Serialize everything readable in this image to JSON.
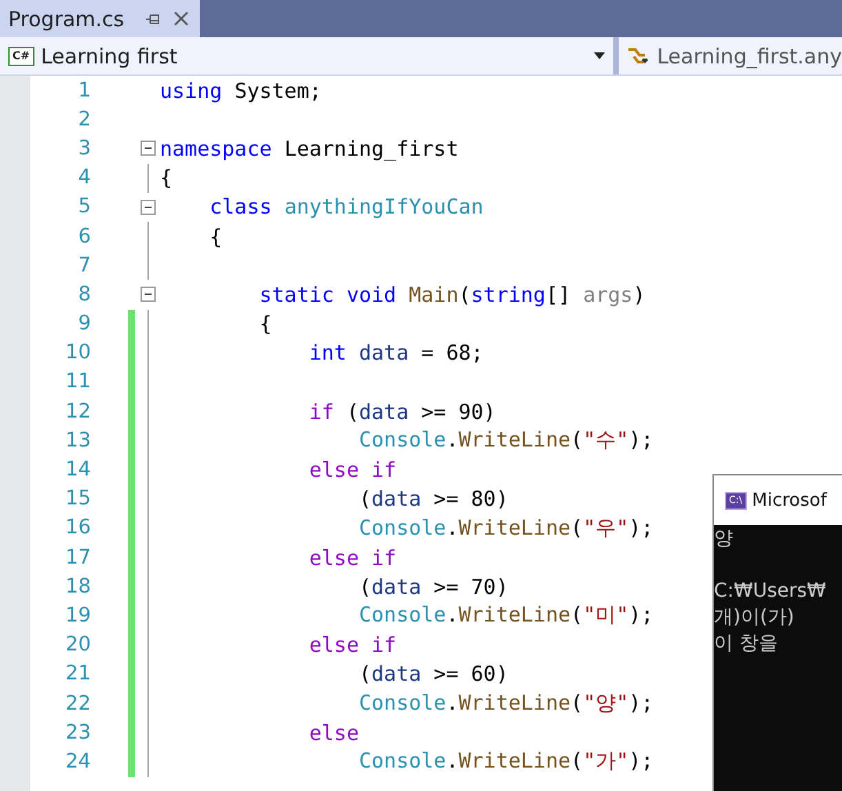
{
  "tab": {
    "title": "Program.cs",
    "selected": true
  },
  "nav": {
    "project_icon": "C#",
    "project": "Learning first",
    "member": "Learning_first.any"
  },
  "lines": [
    {
      "number": "1",
      "changed": false,
      "collapsible": false,
      "tokens": [
        {
          "kind": "keyword",
          "text": "using "
        },
        {
          "kind": "plain",
          "text": "System;"
        }
      ]
    },
    {
      "number": "2",
      "changed": false,
      "collapsible": false
    },
    {
      "number": "3",
      "changed": false,
      "collapsible": true,
      "tokens": [
        {
          "kind": "keyword",
          "text": "namespace "
        },
        {
          "kind": "plain",
          "text": "Learning_first"
        }
      ]
    },
    {
      "number": "4",
      "changed": false,
      "collapsible": false,
      "tokens": [
        {
          "kind": "plain",
          "text": "{"
        }
      ]
    },
    {
      "number": "5",
      "changed": false,
      "collapsible": true,
      "tokens": [
        {
          "kind": "keyword",
          "text": "    class "
        },
        {
          "kind": "type",
          "text": "anythingIfYouCan"
        }
      ]
    },
    {
      "number": "6",
      "changed": false,
      "collapsible": false,
      "tokens": [
        {
          "kind": "plain",
          "text": "    {"
        }
      ]
    },
    {
      "number": "7",
      "changed": false,
      "collapsible": false
    },
    {
      "number": "8",
      "changed": false,
      "collapsible": true,
      "tokens": [
        {
          "kind": "keyword",
          "text": "        static void "
        },
        {
          "kind": "method",
          "text": "Main"
        },
        {
          "kind": "plain",
          "text": "("
        },
        {
          "kind": "keyword",
          "text": "string"
        },
        {
          "kind": "plain",
          "text": "[] "
        },
        {
          "kind": "param",
          "text": "args"
        },
        {
          "kind": "plain",
          "text": ")"
        }
      ]
    },
    {
      "number": "9",
      "changed": true,
      "collapsible": false,
      "tokens": [
        {
          "kind": "plain",
          "text": "        {"
        }
      ]
    },
    {
      "number": "10",
      "changed": true,
      "collapsible": false,
      "tokens": [
        {
          "kind": "keyword",
          "text": "            int "
        },
        {
          "kind": "local",
          "text": "data"
        },
        {
          "kind": "plain",
          "text": " = 68;"
        }
      ]
    },
    {
      "number": "11",
      "changed": true,
      "collapsible": false
    },
    {
      "number": "12",
      "changed": true,
      "collapsible": false,
      "tokens": [
        {
          "kind": "control",
          "text": "            if"
        },
        {
          "kind": "plain",
          "text": " ("
        },
        {
          "kind": "local",
          "text": "data"
        },
        {
          "kind": "plain",
          "text": " >= 90)"
        }
      ]
    },
    {
      "number": "13",
      "changed": true,
      "collapsible": false,
      "tokens": [
        {
          "kind": "type",
          "text": "                Console"
        },
        {
          "kind": "plain",
          "text": "."
        },
        {
          "kind": "method",
          "text": "WriteLine"
        },
        {
          "kind": "plain",
          "text": "("
        },
        {
          "kind": "string",
          "text": "\"수\""
        },
        {
          "kind": "plain",
          "text": ");"
        }
      ]
    },
    {
      "number": "14",
      "changed": true,
      "collapsible": false,
      "tokens": [
        {
          "kind": "control",
          "text": "            else if"
        }
      ]
    },
    {
      "number": "15",
      "changed": true,
      "collapsible": false,
      "tokens": [
        {
          "kind": "plain",
          "text": "                ("
        },
        {
          "kind": "local",
          "text": "data"
        },
        {
          "kind": "plain",
          "text": " >= 80)"
        }
      ]
    },
    {
      "number": "16",
      "changed": true,
      "collapsible": false,
      "tokens": [
        {
          "kind": "type",
          "text": "                Console"
        },
        {
          "kind": "plain",
          "text": "."
        },
        {
          "kind": "method",
          "text": "WriteLine"
        },
        {
          "kind": "plain",
          "text": "("
        },
        {
          "kind": "string",
          "text": "\"우\""
        },
        {
          "kind": "plain",
          "text": ");"
        }
      ]
    },
    {
      "number": "17",
      "changed": true,
      "collapsible": false,
      "tokens": [
        {
          "kind": "control",
          "text": "            else if"
        }
      ]
    },
    {
      "number": "18",
      "changed": true,
      "collapsible": false,
      "tokens": [
        {
          "kind": "plain",
          "text": "                ("
        },
        {
          "kind": "local",
          "text": "data"
        },
        {
          "kind": "plain",
          "text": " >= 70)"
        }
      ]
    },
    {
      "number": "19",
      "changed": true,
      "collapsible": false,
      "tokens": [
        {
          "kind": "type",
          "text": "                Console"
        },
        {
          "kind": "plain",
          "text": "."
        },
        {
          "kind": "method",
          "text": "WriteLine"
        },
        {
          "kind": "plain",
          "text": "("
        },
        {
          "kind": "string",
          "text": "\"미\""
        },
        {
          "kind": "plain",
          "text": ");"
        }
      ]
    },
    {
      "number": "20",
      "changed": true,
      "collapsible": false,
      "tokens": [
        {
          "kind": "control",
          "text": "            else if"
        }
      ]
    },
    {
      "number": "21",
      "changed": true,
      "collapsible": false,
      "tokens": [
        {
          "kind": "plain",
          "text": "                ("
        },
        {
          "kind": "local",
          "text": "data"
        },
        {
          "kind": "plain",
          "text": " >= 60)"
        }
      ]
    },
    {
      "number": "22",
      "changed": true,
      "collapsible": false,
      "tokens": [
        {
          "kind": "type",
          "text": "                Console"
        },
        {
          "kind": "plain",
          "text": "."
        },
        {
          "kind": "method",
          "text": "WriteLine"
        },
        {
          "kind": "plain",
          "text": "("
        },
        {
          "kind": "string",
          "text": "\"양\""
        },
        {
          "kind": "plain",
          "text": ");"
        }
      ]
    },
    {
      "number": "23",
      "changed": true,
      "collapsible": false,
      "tokens": [
        {
          "kind": "control",
          "text": "            else"
        }
      ]
    },
    {
      "number": "24",
      "changed": true,
      "collapsible": false,
      "tokens": [
        {
          "kind": "type",
          "text": "                Console"
        },
        {
          "kind": "plain",
          "text": "."
        },
        {
          "kind": "method",
          "text": "WriteLine"
        },
        {
          "kind": "plain",
          "text": "("
        },
        {
          "kind": "string",
          "text": "\"가\""
        },
        {
          "kind": "plain",
          "text": ");"
        }
      ]
    }
  ],
  "console": {
    "icon": "C:\\",
    "title": "Microsof",
    "output": "양\n\nC:₩Users₩\n개)이(가)\n이 창을"
  }
}
